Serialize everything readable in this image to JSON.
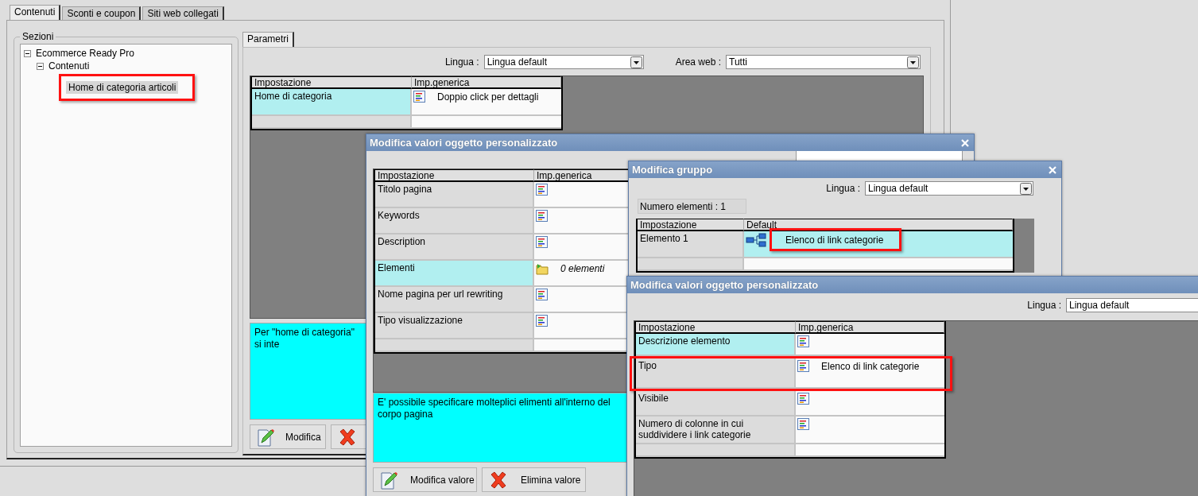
{
  "main_tabs": [
    {
      "label": "Contenuti",
      "selected": true
    },
    {
      "label": "Sconti e coupon",
      "selected": false
    },
    {
      "label": "Siti web collegati",
      "selected": false
    }
  ],
  "sections": {
    "title": "Sezioni",
    "tree": [
      {
        "label": "Ecommerce Ready Pro",
        "expanded": true,
        "selected": false,
        "children": [
          {
            "label": "Contenuti",
            "expanded": true,
            "selected": false,
            "children": [
              {
                "label": "Home di categoria articoli",
                "selected": true,
                "highlighted": true
              }
            ]
          }
        ]
      }
    ]
  },
  "parameters": {
    "tabs": [
      {
        "label": "Parametri",
        "selected": true
      }
    ],
    "filters": [
      {
        "label": "Lingua :",
        "value": "Lingua default"
      },
      {
        "label": "Area web :",
        "value": "Tutti"
      }
    ],
    "table": {
      "kind": "settings",
      "columns": [
        "Impostazione",
        "Imp.generica"
      ],
      "rows": [
        {
          "setting": "Home di categoria",
          "kind": "text",
          "value": "Doppio click per dettagli",
          "selected": true
        }
      ]
    },
    "help": "Per \"home di categoria\" si inte",
    "buttons": [
      {
        "kind": "edit",
        "label": "Modifica"
      },
      {
        "kind": "delete"
      }
    ]
  },
  "dialogs": [
    {
      "title": "Modifica valori oggetto personalizzato",
      "table": {
        "kind": "settings",
        "columns": [
          "Impostazione",
          "Imp.generica"
        ],
        "rows": [
          {
            "setting": "Titolo pagina",
            "kind": "text",
            "selected": false
          },
          {
            "setting": "Keywords",
            "kind": "text",
            "selected": false
          },
          {
            "setting": "Description",
            "kind": "text",
            "selected": false
          },
          {
            "setting": "Elementi",
            "kind": "folder",
            "value": "0 elementi",
            "selected": true
          },
          {
            "setting": "Nome pagina per url rewriting",
            "kind": "text",
            "selected": false
          },
          {
            "setting": "Tipo visualizzazione",
            "kind": "text",
            "selected": false
          }
        ]
      },
      "help": "E' possibile specificare molteplici elimenti all'interno del corpo pagina",
      "buttons": [
        {
          "kind": "edit",
          "label": "Modifica valore"
        },
        {
          "kind": "delete",
          "label": "Elimina valore"
        }
      ]
    },
    {
      "title": "Modifica gruppo",
      "filters": [
        {
          "label": "Lingua :",
          "value": "Lingua default"
        }
      ],
      "count": "Numero elementi : 1",
      "table": {
        "kind": "group",
        "columns": [
          "Impostazione",
          "Default"
        ],
        "rows": [
          {
            "setting": "Elemento 1",
            "kind": "tree",
            "value": "Elenco di link categorie",
            "selected": true,
            "highlighted": true
          }
        ]
      }
    },
    {
      "title": "Modifica valori oggetto personalizzato",
      "filters": [
        {
          "label": "Lingua :",
          "value": "Lingua default"
        }
      ],
      "table": {
        "kind": "settings",
        "columns": [
          "Impostazione",
          "Imp.generica"
        ],
        "rows": [
          {
            "setting": "Descrizione elemento",
            "kind": "text",
            "selected": true
          },
          {
            "setting": "Tipo",
            "kind": "text",
            "value": "Elenco di link categorie",
            "selected": false,
            "highlighted": true
          },
          {
            "setting": "Visibile",
            "kind": "text",
            "selected": false
          },
          {
            "setting": "Numero di colonne in cui suddividere i link categorie",
            "kind": "text",
            "selected": false
          }
        ]
      }
    }
  ]
}
